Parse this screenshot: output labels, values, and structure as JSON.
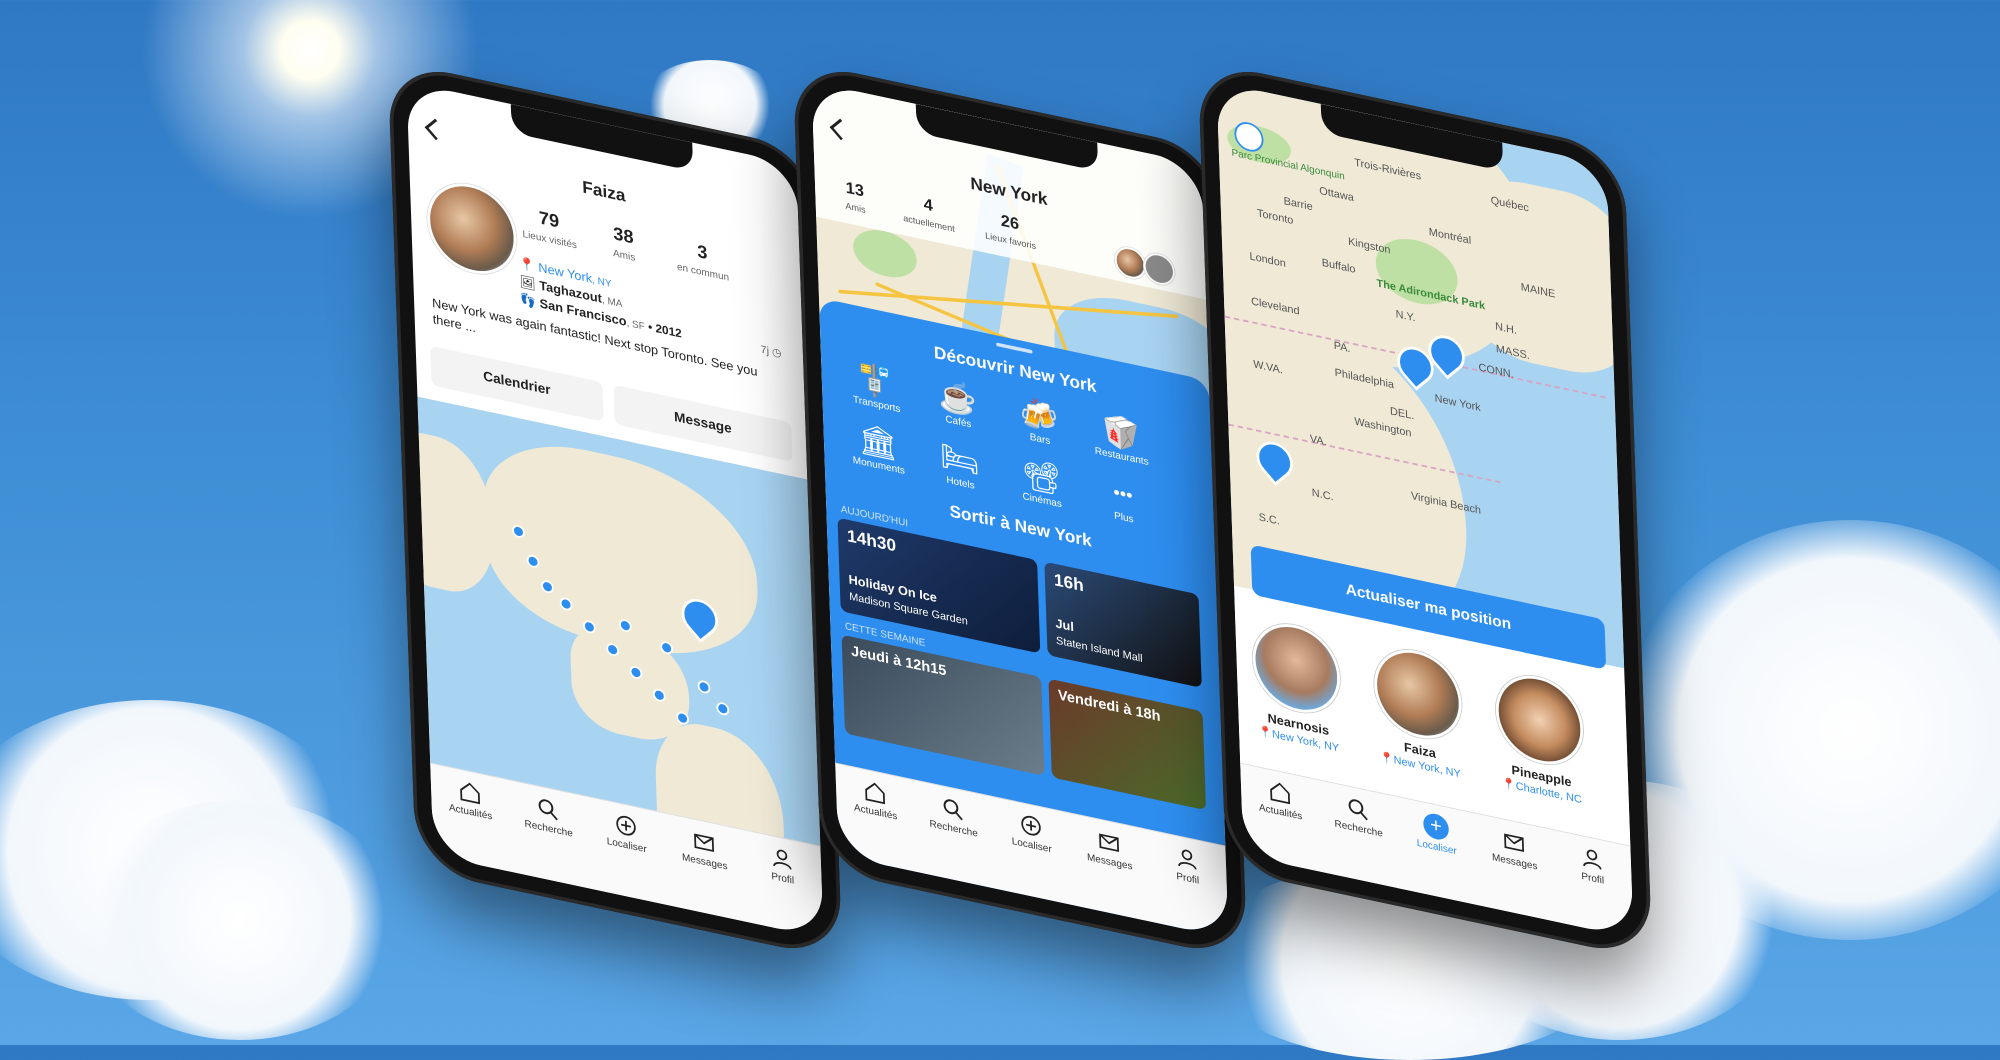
{
  "tabs": [
    "Actualités",
    "Recherche",
    "Localiser",
    "Messages",
    "Profil"
  ],
  "profile": {
    "name": "Faiza",
    "stats": [
      {
        "value": "79",
        "label": "Lieux visités"
      },
      {
        "value": "38",
        "label": "Amis"
      },
      {
        "value": "3",
        "label": "en commun"
      }
    ],
    "cities": [
      {
        "city": "New York",
        "state": ", NY",
        "suffix": ""
      },
      {
        "city": "Taghazout",
        "state": ", MA",
        "suffix": ""
      },
      {
        "city": "San Francisco",
        "state": ", SF",
        "suffix": " • 2012"
      }
    ],
    "post_age": "7j",
    "bio": "New York was again fantastic! Next stop Toronto. See you there ...",
    "calendar_button": "Calendrier",
    "message_button": "Message"
  },
  "city": {
    "name": "New York",
    "stats": [
      {
        "value": "13",
        "label": "Amis"
      },
      {
        "value": "4",
        "label": "actuellement"
      },
      {
        "value": "26",
        "label": "Lieux favoris"
      }
    ],
    "discover_title": "Découvrir New York",
    "categories": [
      "Transports",
      "Cafés",
      "Bars",
      "Restaurants",
      "Monuments",
      "Hotels",
      "Cinémas",
      "Plus"
    ],
    "category_icons": [
      "🚏",
      "☕",
      "🍻",
      "🥡",
      "🏛",
      "🛏",
      "📽",
      "•••"
    ],
    "outings_title": "Sortir à New York",
    "today_label": "AUJOURD'HUI",
    "week_label": "CETTE SEMAINE",
    "events": [
      {
        "time": "14h30",
        "name": "Holiday On Ice",
        "venue": "Madison Square Garden"
      },
      {
        "time": "16h",
        "name": "Jul",
        "venue": "Staten Island Mall"
      },
      {
        "time": "Jeudi à 12h15",
        "name": "",
        "venue": ""
      },
      {
        "time": "Vendredi à 18h",
        "name": "",
        "venue": ""
      }
    ]
  },
  "locate": {
    "update_button": "Actualiser ma position",
    "friends": [
      {
        "name": "Nearnosis",
        "city": "New York",
        "state": ", NY"
      },
      {
        "name": "Faiza",
        "city": "New York",
        "state": ", NY"
      },
      {
        "name": "Pineapple",
        "city": "Charlotte",
        "state": ", NC"
      }
    ],
    "map_labels": [
      "Parc Provincial Algonquin",
      "Trois-Rivières",
      "Ottawa",
      "Québec",
      "Montréal",
      "Toronto",
      "Barrie",
      "Kingston",
      "Buffalo",
      "London",
      "The Adirondack Park",
      "Cleveland",
      "N.Y.",
      "N.H.",
      "MASS.",
      "CONN.",
      "PA.",
      "Philadelphia",
      "New York",
      "W.VA.",
      "DEL.",
      "Washington",
      "VA.",
      "Virginia Beach",
      "N.C.",
      "S.C.",
      "MAINE"
    ]
  },
  "colors": {
    "accent": "#2e8ef0",
    "sky": "#3f8fd6",
    "water": "#a8d4f2",
    "land": "#efe9d6"
  }
}
